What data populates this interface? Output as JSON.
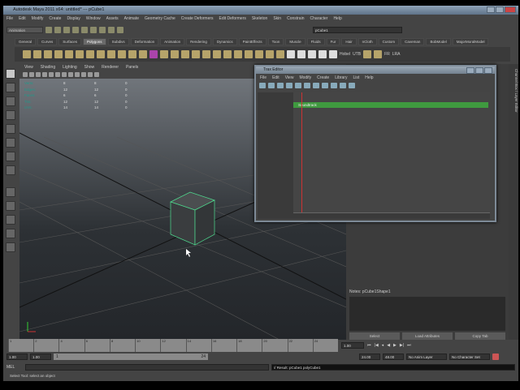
{
  "window": {
    "title": "Autodesk Maya 2011 x64: untitled*  ---  pCube1"
  },
  "menu": [
    "File",
    "Edit",
    "Modify",
    "Create",
    "Display",
    "Window",
    "Assets",
    "Animate",
    "Geometry Cache",
    "Create Deformers",
    "Edit Deformers",
    "Skeleton",
    "Skin",
    "Constrain",
    "Character",
    "Help"
  ],
  "statusline": {
    "menuset": "Animation",
    "selection_field": "pCube1"
  },
  "shelf_tabs": [
    "General",
    "Curves",
    "Surfaces",
    "Polygons",
    "Subdivs",
    "Deformation",
    "Animation",
    "Rendering",
    "Dynamics",
    "PaintEffects",
    "Toon",
    "Muscle",
    "Fluids",
    "Fur",
    "Hair",
    "nCloth",
    "Custom",
    "Caveman",
    "BobModel",
    "MajorMoralModel"
  ],
  "active_shelf": "Polygons",
  "shelf_labels": [
    "Hobel",
    "UTB",
    "FR",
    "LRA"
  ],
  "viewport": {
    "menu": [
      "View",
      "Shading",
      "Lighting",
      "Show",
      "Renderer",
      "Panels"
    ],
    "hud": [
      {
        "label": "Verts:",
        "v": [
          "8",
          "8",
          "0"
        ]
      },
      {
        "label": "Edges:",
        "v": [
          "12",
          "12",
          "0"
        ]
      },
      {
        "label": "Faces:",
        "v": [
          "6",
          "6",
          "0"
        ]
      },
      {
        "label": "Tris:",
        "v": [
          "12",
          "12",
          "0"
        ]
      },
      {
        "label": "UVs:",
        "v": [
          "14",
          "14",
          "0"
        ]
      }
    ]
  },
  "trax": {
    "title": "Trax Editor",
    "menu": [
      "File",
      "Edit",
      "View",
      "Modify",
      "Create",
      "Library",
      "List",
      "Help"
    ],
    "track": "Soundtrack"
  },
  "side_tab": "Channel Box / Layer Editor",
  "attr": {
    "notes": "Notes: pCube1Shape1",
    "select": "Select",
    "load": "Load Attributes",
    "copy": "Copy Tab"
  },
  "timeline": {
    "ticks": [
      "1",
      "2",
      "4",
      "6",
      "8",
      "10",
      "12",
      "14",
      "16",
      "18",
      "20",
      "22",
      "24"
    ],
    "current": "1.00"
  },
  "range": {
    "start": "1.00",
    "inner_start": "1.00",
    "slider_start": "1",
    "slider_end": "24",
    "end": "24.00",
    "outer_end": "48.00",
    "anim_layer": "No Anim Layer",
    "char_set": "No Character Set"
  },
  "cmd": {
    "label": "MEL",
    "result": "// Result: pCube1 polyCube1"
  },
  "help": "Select Tool: select an object"
}
